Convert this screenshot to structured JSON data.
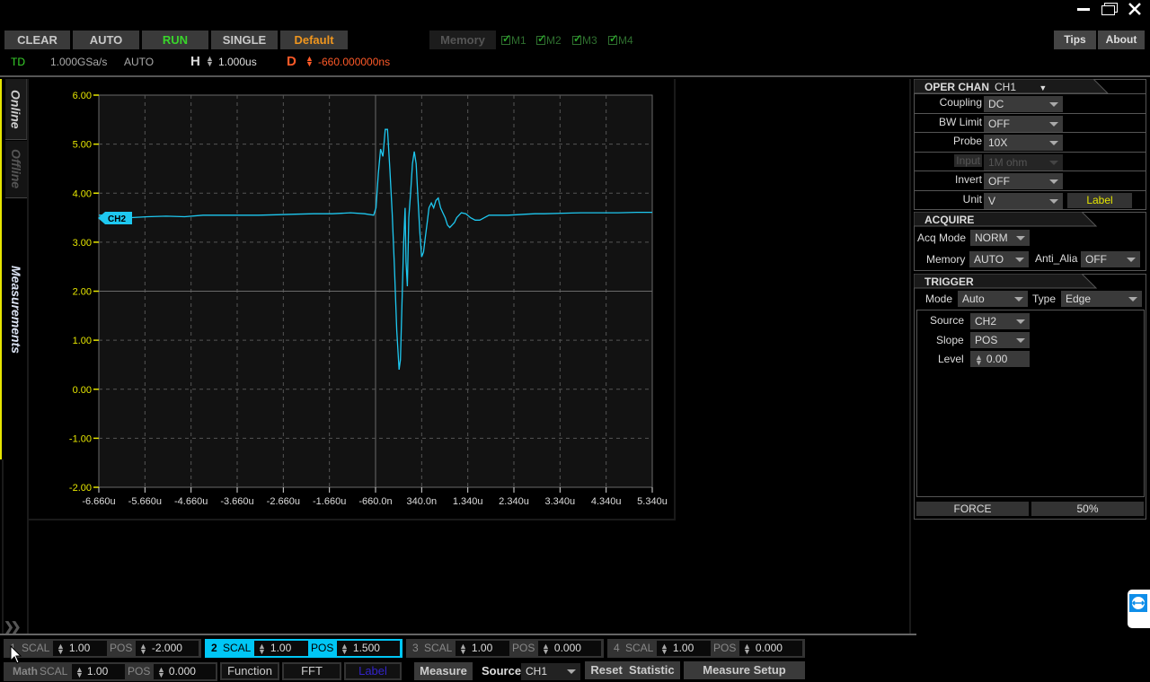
{
  "window": {
    "minimize_icon": "minimize-icon",
    "restore_icon": "restore-icon",
    "close_icon": "close-icon"
  },
  "toolbar": {
    "clear": "CLEAR",
    "auto": "AUTO",
    "run": "RUN",
    "single": "SINGLE",
    "default": "Default",
    "memory": "Memory",
    "memory_slots": [
      {
        "label": "M1",
        "checked": true
      },
      {
        "label": "M2",
        "checked": true
      },
      {
        "label": "M3",
        "checked": true
      },
      {
        "label": "M4",
        "checked": true
      }
    ],
    "tips": "Tips",
    "about": "About"
  },
  "status": {
    "mode": "TD",
    "sample_rate": "1.000GSa/s",
    "acq": "AUTO",
    "h_label": "H",
    "h_value": "1.000us",
    "d_label": "D",
    "d_value": "-660.000000ns"
  },
  "side_tabs": {
    "online": "Online",
    "offline": "Offline",
    "measurements": "Measurements"
  },
  "colors": {
    "trace": "#1ec8f0",
    "axis_labels": "#e6e600",
    "run": "#39d52b",
    "default": "#f0961e",
    "delay": "#ff5a28",
    "label": "#e6e600"
  },
  "chart_data": {
    "type": "line",
    "title": "",
    "xlabel": "",
    "ylabel": "",
    "x_ticks": [
      "-6.660u",
      "-5.660u",
      "-4.660u",
      "-3.660u",
      "-2.660u",
      "-1.660u",
      "-660.0n",
      "340.0n",
      "1.340u",
      "2.340u",
      "3.340u",
      "4.340u",
      "5.340u"
    ],
    "y_ticks": [
      "6.00",
      "5.00",
      "4.00",
      "3.00",
      "2.00",
      "1.00",
      "0.00",
      "-1.00",
      "-2.00"
    ],
    "xlim_us": [
      -6.66,
      5.34
    ],
    "ylim": [
      -2,
      6
    ],
    "grid": true,
    "channel_marker": "CH2",
    "series": [
      {
        "name": "CH2",
        "x_us": [
          -6.66,
          -6.3,
          -6.0,
          -5.6,
          -5.2,
          -4.8,
          -4.4,
          -4.0,
          -3.6,
          -3.2,
          -2.8,
          -2.4,
          -2.0,
          -1.6,
          -1.2,
          -0.9,
          -0.7,
          -0.65,
          -0.6,
          -0.55,
          -0.5,
          -0.45,
          -0.4,
          -0.35,
          -0.3,
          -0.25,
          -0.2,
          -0.15,
          -0.12,
          -0.08,
          -0.05,
          -0.02,
          0.0,
          0.03,
          0.06,
          0.1,
          0.14,
          0.18,
          0.22,
          0.26,
          0.3,
          0.34,
          0.38,
          0.42,
          0.46,
          0.5,
          0.55,
          0.6,
          0.65,
          0.7,
          0.75,
          0.8,
          0.85,
          0.9,
          0.95,
          1.0,
          1.05,
          1.1,
          1.15,
          1.2,
          1.3,
          1.4,
          1.5,
          1.6,
          1.7,
          1.8,
          2.0,
          2.2,
          2.4,
          2.6,
          2.8,
          3.0,
          3.4,
          3.8,
          4.2,
          4.6,
          5.0,
          5.34
        ],
        "values": [
          3.55,
          3.55,
          3.5,
          3.52,
          3.53,
          3.52,
          3.55,
          3.55,
          3.55,
          3.55,
          3.56,
          3.57,
          3.58,
          3.58,
          3.6,
          3.58,
          3.55,
          3.7,
          4.4,
          4.9,
          4.75,
          5.3,
          5.3,
          4.5,
          3.6,
          2.5,
          1.2,
          0.4,
          0.6,
          2.0,
          3.0,
          3.7,
          2.6,
          2.1,
          3.5,
          4.0,
          4.6,
          4.85,
          4.6,
          3.9,
          3.2,
          2.7,
          2.8,
          3.1,
          3.4,
          3.7,
          3.8,
          3.7,
          3.85,
          3.9,
          3.7,
          3.6,
          3.5,
          3.35,
          3.3,
          3.35,
          3.4,
          3.5,
          3.55,
          3.6,
          3.58,
          3.5,
          3.45,
          3.45,
          3.5,
          3.55,
          3.55,
          3.55,
          3.56,
          3.57,
          3.58,
          3.58,
          3.59,
          3.6,
          3.6,
          3.6,
          3.61,
          3.61
        ]
      }
    ]
  },
  "oper_chan": {
    "title": "OPER CHAN",
    "channel": "CH1",
    "rows": [
      {
        "label": "Coupling",
        "value": "DC",
        "enabled": true
      },
      {
        "label": "BW Limit",
        "value": "OFF",
        "enabled": true
      },
      {
        "label": "Probe",
        "value": "10X",
        "enabled": true
      },
      {
        "label": "Input",
        "value": "1M ohm",
        "enabled": false
      },
      {
        "label": "Invert",
        "value": "OFF",
        "enabled": true
      },
      {
        "label": "Unit",
        "value": "V",
        "enabled": true
      }
    ],
    "label_button": "Label"
  },
  "acquire": {
    "title": "ACQUIRE",
    "acq_mode_label": "Acq Mode",
    "acq_mode": "NORM",
    "memory_label": "Memory",
    "memory": "AUTO",
    "anti_alias_label": "Anti_Alia",
    "anti_alias": "OFF"
  },
  "trigger": {
    "title": "TRIGGER",
    "mode_label": "Mode",
    "mode": "Auto",
    "type_label": "Type",
    "type": "Edge",
    "source_label": "Source",
    "source": "CH2",
    "slope_label": "Slope",
    "slope": "POS",
    "level_label": "Level",
    "level": "0.00",
    "force": "FORCE",
    "fifty": "50%"
  },
  "channels": [
    {
      "num": "1",
      "scal_label": "SCAL",
      "scal": "1.00",
      "pos_label": "POS",
      "pos": "-2.000",
      "active": false
    },
    {
      "num": "2",
      "scal_label": "SCAL",
      "scal": "1.00",
      "pos_label": "POS",
      "pos": "1.500",
      "active": true
    },
    {
      "num": "3",
      "scal_label": "SCAL",
      "scal": "1.00",
      "pos_label": "POS",
      "pos": "0.000",
      "active": false
    },
    {
      "num": "4",
      "scal_label": "SCAL",
      "scal": "1.00",
      "pos_label": "POS",
      "pos": "0.000",
      "active": false
    }
  ],
  "math": {
    "label": "Math",
    "scal_label": "SCAL",
    "scal": "1.00",
    "pos_label": "POS",
    "pos": "0.000",
    "function": "Function",
    "fft": "FFT",
    "label_btn": "Label"
  },
  "measure": {
    "measure": "Measure",
    "source_label": "Source",
    "source": "CH1",
    "reset": "Reset  Statistic",
    "setup": "Measure Setup"
  }
}
